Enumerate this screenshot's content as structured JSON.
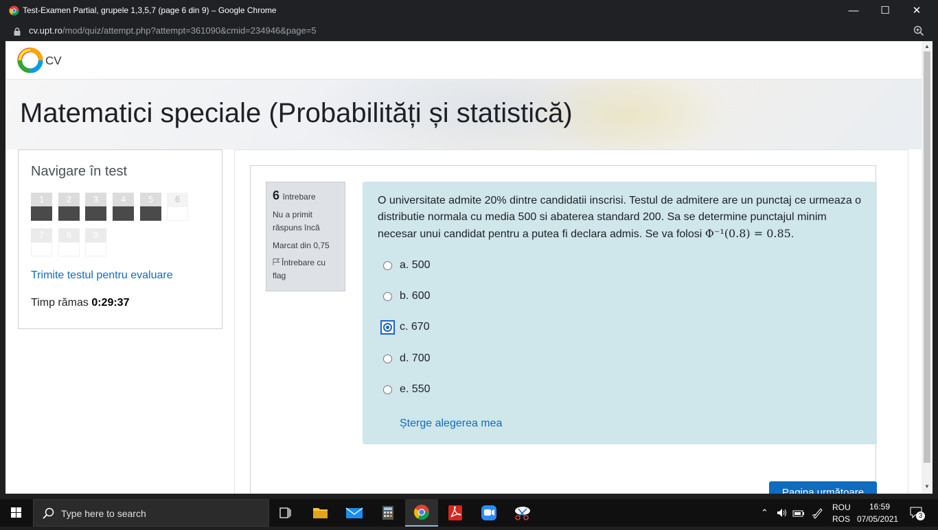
{
  "window": {
    "title": "Test-Examen Partial, grupele 1,3,5,7 (page 6 din 9) – Google Chrome",
    "url_domain": "cv.upt.ro",
    "url_path": "/mod/quiz/attempt.php?attempt=361090&cmid=234946&page=5"
  },
  "site": {
    "logo_text": "CV"
  },
  "course": {
    "title": "Matematici speciale (Probabilități și statistică)"
  },
  "quiz_nav": {
    "title": "Navigare în test",
    "questions": [
      "1",
      "2",
      "3",
      "4",
      "5",
      "6",
      "7",
      "8",
      "9"
    ],
    "submit_link": "Trimite testul pentru evaluare",
    "timer_label": "Timp rămas",
    "timer_value": "0:29:37"
  },
  "question": {
    "number": "6",
    "number_label": "întrebare",
    "status": "Nu a primit răspuns încă",
    "mark": "Marcat din 0,75",
    "flag": "Întrebare cu flag",
    "text": "O universitate admite 20% dintre candidatii inscrisi. Testul de admitere are un punctaj ce urmeaza o distributie normala cu media 500 si abaterea standard 200. Sa se determine punctajul minim necesar unui candidat pentru a putea fi declara admis. Se va folosi",
    "formula": "Φ⁻¹(0.8) = 0.85",
    "options": [
      {
        "label": "a. 500",
        "selected": false
      },
      {
        "label": "b. 600",
        "selected": false
      },
      {
        "label": "c. 670",
        "selected": true
      },
      {
        "label": "d. 700",
        "selected": false
      },
      {
        "label": "e. 550",
        "selected": false
      }
    ],
    "clear_link": "Șterge alegerea mea"
  },
  "next_button": "Pagina următoare",
  "taskbar": {
    "search_placeholder": "Type here to search",
    "lang_top": "ROU",
    "lang_bottom": "ROS",
    "time": "16:59",
    "date": "07/05/2021",
    "notifications": "3"
  }
}
